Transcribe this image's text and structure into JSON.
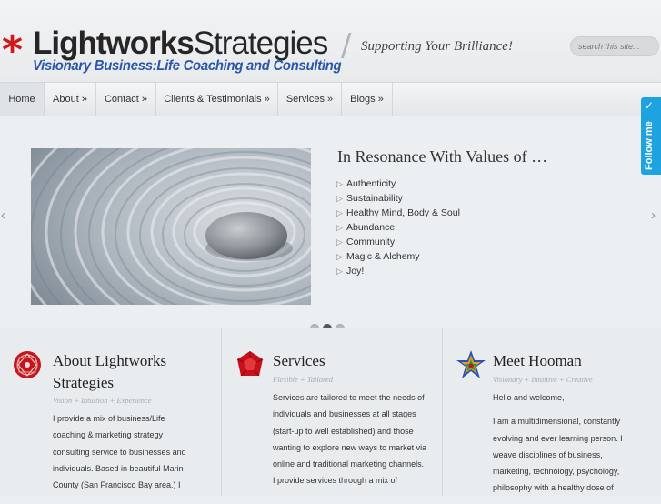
{
  "site": {
    "logo_star": "*",
    "logo_main_bold": "Lightworks",
    "logo_main_rest": "Strategies",
    "logo_sub": "Visionary Business:Life Coaching and Consulting",
    "tagline": "Supporting Your Brilliance!",
    "search_placeholder": "search this site..."
  },
  "nav": {
    "items": [
      {
        "label": "Home"
      },
      {
        "label": "About »"
      },
      {
        "label": "Contact »"
      },
      {
        "label": "Clients & Testimonials »"
      },
      {
        "label": "Services »"
      },
      {
        "label": "Blogs »"
      }
    ],
    "active": "Home"
  },
  "follow": {
    "label": "Follow me",
    "bird": "✓",
    "color": "#1fa3e0"
  },
  "slider": {
    "title": "In Resonance With Values of …",
    "values": [
      "Authenticity",
      "Sustainability",
      "Healthy Mind, Body & Soul",
      "Abundance",
      "Community",
      "Magic & Alchemy",
      "Joy!"
    ],
    "prev": "‹",
    "next": "›",
    "dots": 3,
    "active_dot": 2
  },
  "panels": {
    "about": {
      "title": "About Lightworks Strategies",
      "sub": "Vision + Intuition + Experience",
      "text": "I provide a mix of business/Life coaching & marketing strategy consulting service to businesses and individuals. Based in beautiful Marin County (San Francisco Bay area.) I"
    },
    "services": {
      "title": "Services",
      "sub": "Flexible + Tailored",
      "text": "Services are tailored to meet the needs of individuals and businesses at all stages (start-up to well established) and those wanting to explore new ways to market via online and traditional marketing channels. I provide services through a mix of"
    },
    "meet": {
      "title": "Meet Hooman",
      "sub": "Visionary + Intuitive + Creative",
      "greeting": "Hello and welcome,",
      "text": "I am a multidimensional, constantly evolving and ever learning person. I weave disciplines of business, marketing, technology, psychology, philosophy with a healthy dose of"
    }
  },
  "colors": {
    "star": "#d11919",
    "sub_brand": "#2a57a8"
  }
}
